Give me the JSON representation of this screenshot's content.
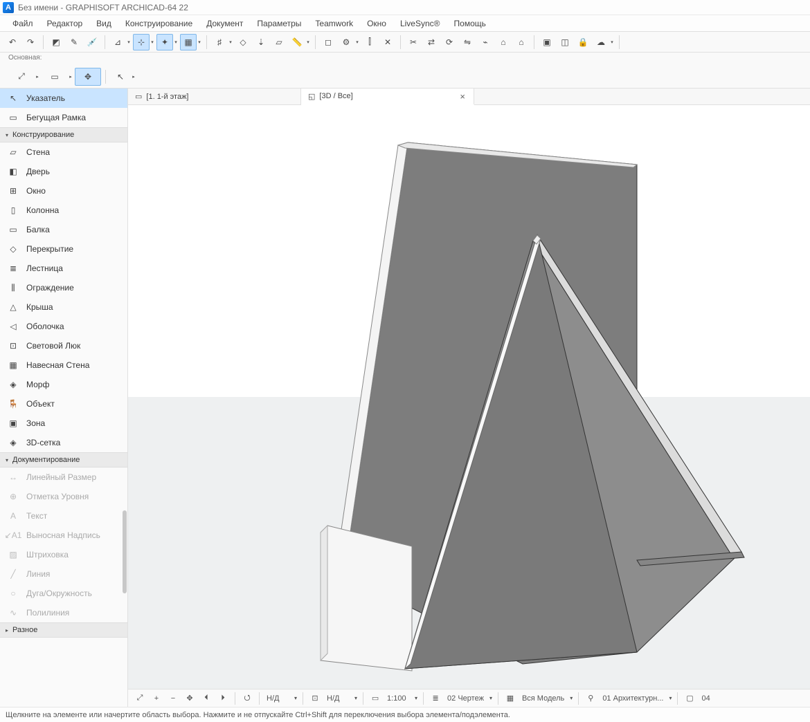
{
  "title": "Без имени - GRAPHISOFT ARCHICAD-64 22",
  "menu": [
    "Файл",
    "Редактор",
    "Вид",
    "Конструирование",
    "Документ",
    "Параметры",
    "Teamwork",
    "Окно",
    "LiveSync®",
    "Помощь"
  ],
  "secondary_label": "Основная:",
  "toolbox": {
    "selection_group": [
      {
        "label": "Указатель",
        "selected": true
      },
      {
        "label": "Бегущая Рамка",
        "selected": false
      }
    ],
    "construction_header": "Конструирование",
    "construction": [
      {
        "label": "Стена"
      },
      {
        "label": "Дверь"
      },
      {
        "label": "Окно"
      },
      {
        "label": "Колонна"
      },
      {
        "label": "Балка"
      },
      {
        "label": "Перекрытие"
      },
      {
        "label": "Лестница"
      },
      {
        "label": "Ограждение"
      },
      {
        "label": "Крыша"
      },
      {
        "label": "Оболочка"
      },
      {
        "label": "Световой Люк"
      },
      {
        "label": "Навесная Стена"
      },
      {
        "label": "Морф"
      },
      {
        "label": "Объект"
      },
      {
        "label": "Зона"
      },
      {
        "label": "3D-сетка"
      }
    ],
    "documentation_header": "Документирование",
    "documentation": [
      {
        "label": "Линейный Размер",
        "disabled": true
      },
      {
        "label": "Отметка Уровня",
        "disabled": true
      },
      {
        "label": "Текст",
        "disabled": true
      },
      {
        "label": "Выносная Надпись",
        "disabled": true
      },
      {
        "label": "Штриховка",
        "disabled": true
      },
      {
        "label": "Линия",
        "disabled": true
      },
      {
        "label": "Дуга/Окружность",
        "disabled": true
      },
      {
        "label": "Полилиния",
        "disabled": true
      }
    ],
    "misc_header": "Разное"
  },
  "tabs": [
    {
      "label": "[1. 1-й этаж]",
      "icon": "plan-icon",
      "active": false,
      "closeable": false
    },
    {
      "label": "[3D / Все]",
      "icon": "cube-icon",
      "active": true,
      "closeable": true
    }
  ],
  "view_controls": {
    "orient1": "Н/Д",
    "orient2": "Н/Д",
    "scale": "1:100",
    "draft": "02 Чертеж",
    "model": "Вся Модель",
    "layer": "01 Архитектурн...",
    "rightnum": "04"
  },
  "statusbar_text": "Щелкните на элементе или начертите область выбора. Нажмите и не отпускайте Ctrl+Shift для переключения выбора элемента/подэлемента."
}
